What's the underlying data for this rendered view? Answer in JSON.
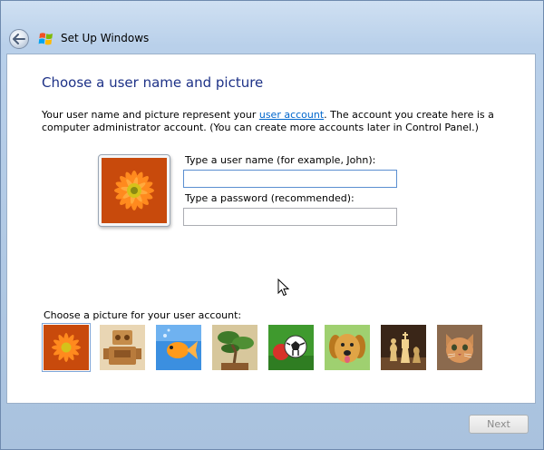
{
  "window": {
    "title": "Set Up Windows",
    "accent": "#1e3287",
    "link_color": "#0066cc"
  },
  "titlebar": {
    "back_icon": "back-arrow-icon",
    "logo_icon": "windows-flag-icon"
  },
  "main": {
    "heading": "Choose a user name and picture",
    "desc_before_link": "Your user name and picture represent your ",
    "desc_link": "user account",
    "desc_after_link": ". The account you create here is a computer administrator account. (You can create more accounts later in Control Panel.)",
    "username_label": "Type a user name (for example, John):",
    "username_value": "",
    "password_label": "Type a password (recommended):",
    "password_value": "",
    "picture_prompt": "Choose a picture for your user account:",
    "pictures": [
      {
        "name": "flower",
        "selected": true
      },
      {
        "name": "robot",
        "selected": false
      },
      {
        "name": "fish",
        "selected": false
      },
      {
        "name": "bonsai",
        "selected": false
      },
      {
        "name": "soccer-ball",
        "selected": false
      },
      {
        "name": "dog",
        "selected": false
      },
      {
        "name": "chess",
        "selected": false
      },
      {
        "name": "kitten",
        "selected": false
      }
    ]
  },
  "footer": {
    "next_label": "Next",
    "next_enabled": false
  }
}
